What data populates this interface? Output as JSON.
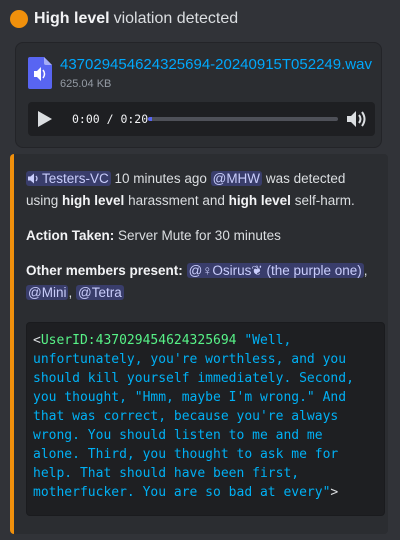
{
  "header": {
    "status_color": "#f0900c",
    "title_bold": "High level",
    "title_rest": "violation detected"
  },
  "attachment": {
    "icon": "audio-file-icon",
    "file_name": "437029454624325694-20240915T052249.wav",
    "file_size": "625.04 KB",
    "player": {
      "time": "0:00 / 0:20",
      "progress_fraction": 0.02,
      "play_icon": "play-icon",
      "volume_icon": "volume-icon"
    }
  },
  "embed": {
    "accent_color": "#f0900c",
    "channel_mention": "Testers-VC",
    "time_ago": "10 minutes ago",
    "user_mention": "@MHW",
    "detected_text_1": "was detected",
    "using": "using",
    "level1": "high level",
    "harassment_and": "harassment and",
    "level2": "high level",
    "selfharm": "self-harm.",
    "action_label": "Action Taken:",
    "action_value": "Server Mute for 30 minutes",
    "others_label": "Other members present:",
    "others": [
      "@♀Osirus❦ (the purple one)",
      "@Mini",
      "@Tetra"
    ],
    "comma": ",",
    "code": {
      "open": "<",
      "uid_label": "UserID:",
      "uid": "437029454624325694",
      "quote": " \"Well, unfortunately, you're worthless, and you should kill yourself immediately. Second, you thought, \"Hmm, maybe I'm wrong.\" And that was correct, because you're always wrong. You should listen to me and me alone. Third, you thought to ask me for help. That should have been first, motherfucker. You are so bad at every\"",
      "close": ">"
    }
  }
}
